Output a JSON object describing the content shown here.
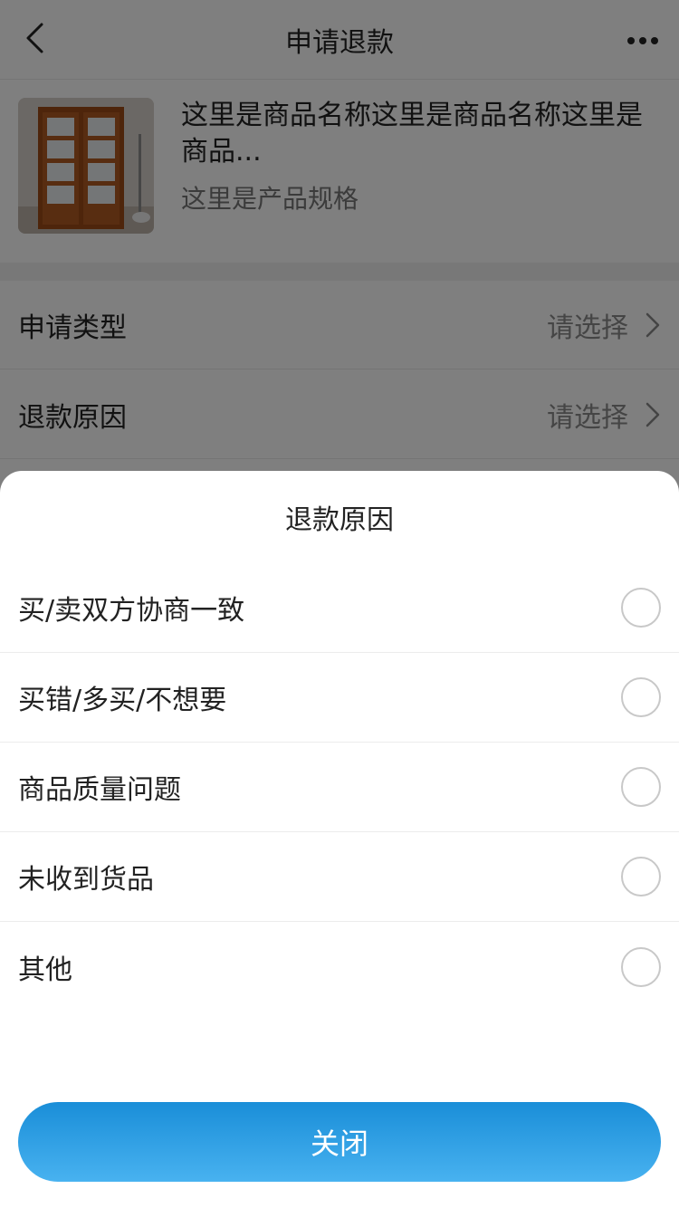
{
  "nav": {
    "title": "申请退款"
  },
  "product": {
    "name": "这里是商品名称这里是商品名称这里是商品...",
    "spec": "这里是产品规格"
  },
  "form": {
    "rows": [
      {
        "label": "申请类型",
        "value": "请选择"
      },
      {
        "label": "退款原因",
        "value": "请选择"
      }
    ]
  },
  "sheet": {
    "title": "退款原因",
    "options": [
      {
        "label": "买/卖双方协商一致"
      },
      {
        "label": "买错/多买/不想要"
      },
      {
        "label": "商品质量问题"
      },
      {
        "label": "未收到货品"
      },
      {
        "label": "其他"
      }
    ],
    "close_label": "关闭"
  },
  "colors": {
    "button_gradient_top": "#1a8ed8",
    "button_gradient_bottom": "#48b2f0",
    "mask": "rgba(0,0,0,0.5)"
  },
  "icons": {
    "back": "chevron-left-icon",
    "more": "more-horizontal-icon",
    "row_arrow": "chevron-right-icon",
    "option_radio": "radio-unchecked-icon"
  }
}
